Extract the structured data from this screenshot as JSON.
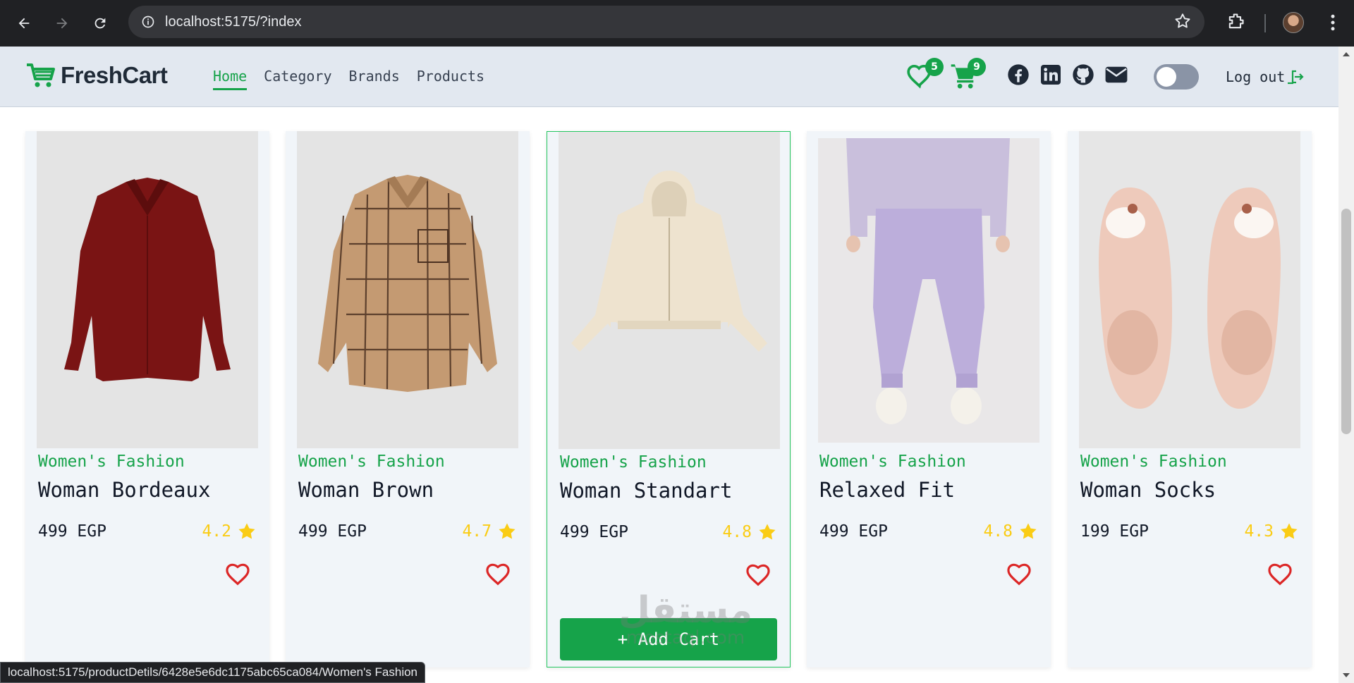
{
  "browser": {
    "url": "localhost:5175/?index",
    "status_url": "localhost:5175/productDetils/6428e5e6dc1175abc65ca084/Women's Fashion"
  },
  "navbar": {
    "brand": "FreshCart",
    "links": [
      "Home",
      "Category",
      "Brands",
      "Products"
    ],
    "active_link": "Home",
    "wishlist_count": "5",
    "cart_count": "9",
    "social_icons": [
      "facebook-icon",
      "linkedin-icon",
      "github-icon",
      "envelope-icon"
    ],
    "theme_toggle_on": false,
    "logout_label": "Log out"
  },
  "colors": {
    "accent": "#16a34a",
    "star": "#facc15",
    "heart": "#dc2626",
    "navbar_bg": "#e2e8f0",
    "card_bg": "#f1f5f9"
  },
  "products": [
    {
      "category": "Women's Fashion",
      "name": "Woman Bordeaux",
      "price": "499 EGP",
      "rating": "4.2",
      "image": "burgundy-shirt"
    },
    {
      "category": "Women's Fashion",
      "name": "Woman Brown",
      "price": "499 EGP",
      "rating": "4.7",
      "image": "plaid-shirt"
    },
    {
      "category": "Women's Fashion",
      "name": "Woman Standart",
      "price": "499 EGP",
      "rating": "4.8",
      "image": "beige-hoodie",
      "hovered": true,
      "add_cart_label": "+ Add Cart"
    },
    {
      "category": "Women's Fashion",
      "name": "Relaxed Fit",
      "price": "499 EGP",
      "rating": "4.8",
      "image": "lilac-joggers"
    },
    {
      "category": "Women's Fashion",
      "name": "Woman Socks",
      "price": "199 EGP",
      "rating": "4.3",
      "image": "fuzzy-socks"
    }
  ],
  "watermark": {
    "arabic": "مستقل",
    "latin": "mostaql.com"
  }
}
